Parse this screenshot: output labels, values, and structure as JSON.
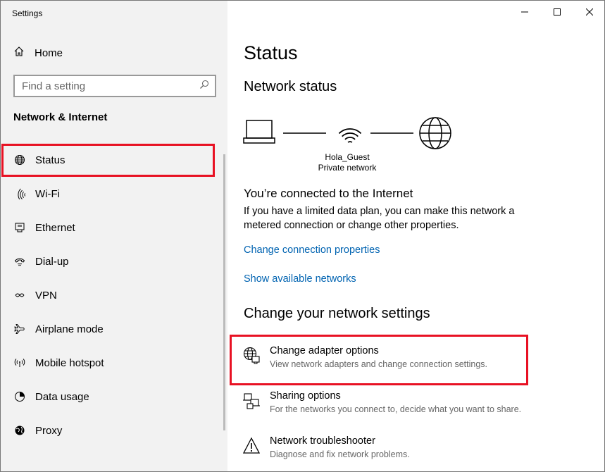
{
  "window": {
    "title": "Settings"
  },
  "sidebar": {
    "home_label": "Home",
    "search": {
      "placeholder": "Find a setting"
    },
    "section_title": "Network & Internet",
    "items": [
      {
        "label": "Status",
        "icon": "globe-icon"
      },
      {
        "label": "Wi-Fi",
        "icon": "wifi-icon"
      },
      {
        "label": "Ethernet",
        "icon": "ethernet-icon"
      },
      {
        "label": "Dial-up",
        "icon": "dialup-icon"
      },
      {
        "label": "VPN",
        "icon": "vpn-icon"
      },
      {
        "label": "Airplane mode",
        "icon": "airplane-icon"
      },
      {
        "label": "Mobile hotspot",
        "icon": "hotspot-icon"
      },
      {
        "label": "Data usage",
        "icon": "data-usage-icon"
      },
      {
        "label": "Proxy",
        "icon": "proxy-globe-icon"
      }
    ]
  },
  "main": {
    "title": "Status",
    "network_status_heading": "Network status",
    "network": {
      "name": "Hola_Guest",
      "type": "Private network"
    },
    "connection": {
      "title": "You’re connected to the Internet",
      "description": "If you have a limited data plan, you can make this network a metered connection or change other properties."
    },
    "links": {
      "change_properties": "Change connection properties",
      "show_networks": "Show available networks"
    },
    "change_heading": "Change your network settings",
    "options": [
      {
        "title": "Change adapter options",
        "desc": "View network adapters and change connection settings.",
        "icon": "adapter-globe-icon"
      },
      {
        "title": "Sharing options",
        "desc": "For the networks you connect to, decide what you want to share.",
        "icon": "sharing-icon"
      },
      {
        "title": "Network troubleshooter",
        "desc": "Diagnose and fix network problems.",
        "icon": "warning-icon"
      }
    ]
  },
  "colors": {
    "accent_link": "#0063b1",
    "highlight": "#e81123",
    "sidebar_bg": "#f2f2f2"
  }
}
